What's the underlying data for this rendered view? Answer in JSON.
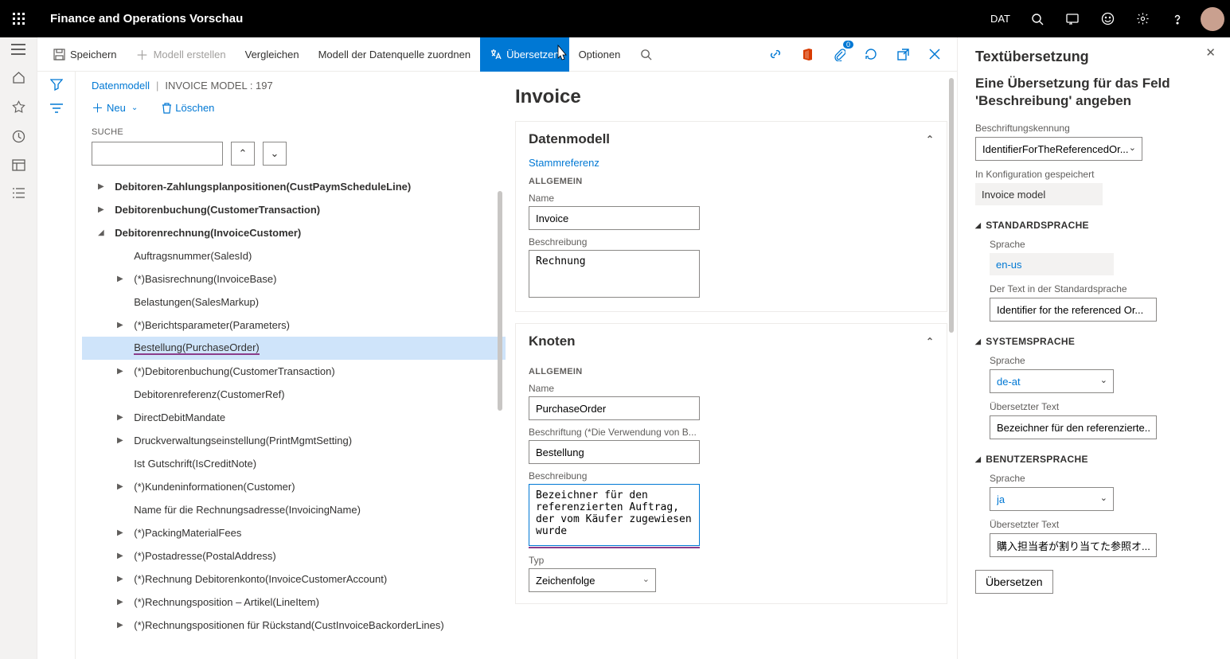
{
  "topbar": {
    "title": "Finance and Operations Vorschau",
    "company": "DAT"
  },
  "cmdbar": {
    "save": "Speichern",
    "create_model": "Modell erstellen",
    "compare": "Vergleichen",
    "map_model": "Modell der Datenquelle zuordnen",
    "translate": "Übersetzen",
    "options": "Optionen",
    "badge": "0"
  },
  "breadcrumb": {
    "root": "Datenmodell",
    "current": "INVOICE MODEL : 197"
  },
  "tree": {
    "new": "Neu",
    "delete": "Löschen",
    "search_label": "SUCHE",
    "nodes": [
      {
        "level": 0,
        "chev": "▶",
        "label": "Debitoren-Zahlungsplanpositionen(CustPaymScheduleLine)"
      },
      {
        "level": 0,
        "chev": "▶",
        "label": "Debitorenbuchung(CustomerTransaction)"
      },
      {
        "level": 0,
        "chev": "◢",
        "label": "Debitorenrechnung(InvoiceCustomer)"
      },
      {
        "level": 1,
        "chev": "",
        "label": "Auftragsnummer(SalesId)"
      },
      {
        "level": 1,
        "chev": "▶",
        "label": "(*)Basisrechnung(InvoiceBase)"
      },
      {
        "level": 1,
        "chev": "",
        "label": "Belastungen(SalesMarkup)"
      },
      {
        "level": 1,
        "chev": "▶",
        "label": "(*)Berichtsparameter(Parameters)"
      },
      {
        "level": 1,
        "chev": "",
        "label": "Bestellung(PurchaseOrder)",
        "sel": true,
        "ul": true
      },
      {
        "level": 1,
        "chev": "▶",
        "label": "(*)Debitorenbuchung(CustomerTransaction)"
      },
      {
        "level": 1,
        "chev": "",
        "label": "Debitorenreferenz(CustomerRef)"
      },
      {
        "level": 1,
        "chev": "▶",
        "label": "DirectDebitMandate"
      },
      {
        "level": 1,
        "chev": "▶",
        "label": "Druckverwaltungseinstellung(PrintMgmtSetting)"
      },
      {
        "level": 1,
        "chev": "",
        "label": "Ist Gutschrift(IsCreditNote)"
      },
      {
        "level": 1,
        "chev": "▶",
        "label": "(*)Kundeninformationen(Customer)"
      },
      {
        "level": 1,
        "chev": "",
        "label": "Name für die Rechnungsadresse(InvoicingName)"
      },
      {
        "level": 1,
        "chev": "▶",
        "label": "(*)PackingMaterialFees"
      },
      {
        "level": 1,
        "chev": "▶",
        "label": "(*)Postadresse(PostalAddress)"
      },
      {
        "level": 1,
        "chev": "▶",
        "label": "(*)Rechnung Debitorenkonto(InvoiceCustomerAccount)"
      },
      {
        "level": 1,
        "chev": "▶",
        "label": "(*)Rechnungsposition – Artikel(LineItem)"
      },
      {
        "level": 1,
        "chev": "▶",
        "label": "(*)Rechnungspositionen für Rückstand(CustInvoiceBackorderLines)"
      }
    ]
  },
  "details": {
    "title": "Invoice",
    "dm": {
      "header": "Datenmodell",
      "link": "Stammreferenz",
      "section": "ALLGEMEIN",
      "name_label": "Name",
      "name_value": "Invoice",
      "desc_label": "Beschreibung",
      "desc_value": "Rechnung"
    },
    "node": {
      "header": "Knoten",
      "section": "ALLGEMEIN",
      "name_label": "Name",
      "name_value": "PurchaseOrder",
      "caption_label": "Beschriftung (*Die Verwendung von B...",
      "caption_value": "Bestellung",
      "desc_label": "Beschreibung",
      "desc_value": "Bezeichner für den referenzierten Auftrag, der vom Käufer zugewiesen wurde",
      "type_label": "Typ",
      "type_value": "Zeichenfolge"
    }
  },
  "rp": {
    "title": "Textübersetzung",
    "subtitle": "Eine Übersetzung für das Feld 'Beschreibung' angeben",
    "lk_label": "Beschriftungskennung",
    "lk_value": "IdentifierForTheReferencedOr...",
    "cfg_label": "In Konfiguration gespeichert",
    "cfg_value": "Invoice model",
    "g1": {
      "title": "STANDARDSPRACHE",
      "lang_label": "Sprache",
      "lang_value": "en-us",
      "text_label": "Der Text in der Standardsprache",
      "text_value": "Identifier for the referenced Or..."
    },
    "g2": {
      "title": "SYSTEMSPRACHE",
      "lang_label": "Sprache",
      "lang_value": "de-at",
      "text_label": "Übersetzter Text",
      "text_value": "Bezeichner für den referenzierte..."
    },
    "g3": {
      "title": "BENUTZERSPRACHE",
      "lang_label": "Sprache",
      "lang_value": "ja",
      "text_label": "Übersetzter Text",
      "text_value": "購入担当者が割り当てた参照オ..."
    },
    "btn": "Übersetzen"
  }
}
